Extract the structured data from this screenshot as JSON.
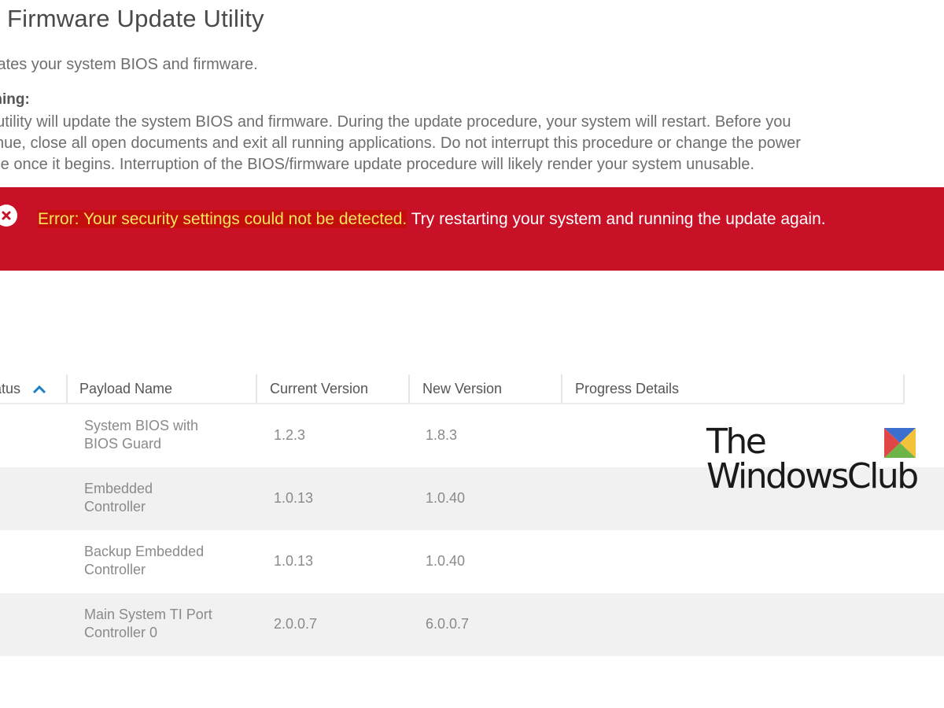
{
  "app": {
    "title": "ll Firmware Update Utility",
    "subtitle": "lates your system BIOS and firmware."
  },
  "warning": {
    "label": "rning:",
    "lines": [
      ". utility will update the system BIOS and firmware. During the update procedure, your system will restart. Before you",
      "tinue, close all open documents and exit all running applications. Do not interrupt this procedure or change the power",
      "rce once it begins. Interruption of the BIOS/firmware update procedure will likely render your system unusable."
    ]
  },
  "error": {
    "icon": "error-x-circle-icon",
    "highlight": "Error: Your security settings could not be detected.",
    "message": " Try restarting your system and running the update again.",
    "colors": {
      "background": "#c81127",
      "highlight_text": "#f8e35a"
    }
  },
  "table": {
    "columns": [
      {
        "label": "atus",
        "sort": "ascending",
        "sort_icon": "chevron-up-icon"
      },
      {
        "label": "Payload Name"
      },
      {
        "label": "Current Version"
      },
      {
        "label": "New Version"
      },
      {
        "label": "Progress Details"
      }
    ],
    "rows": [
      {
        "payload_line1": "System BIOS with",
        "payload_line2": "BIOS Guard",
        "current": "1.2.3",
        "new": "1.8.3",
        "progress": ""
      },
      {
        "payload_line1": "Embedded",
        "payload_line2": "Controller",
        "current": "1.0.13",
        "new": "1.0.40",
        "progress": ""
      },
      {
        "payload_line1": "Backup Embedded",
        "payload_line2": "Controller",
        "current": "1.0.13",
        "new": "1.0.40",
        "progress": ""
      },
      {
        "payload_line1": "Main System TI Port",
        "payload_line2": "Controller 0",
        "current": "2.0.0.7",
        "new": "6.0.0.7",
        "progress": ""
      }
    ],
    "accent": "#1a7fc4"
  },
  "watermark": {
    "line1": "The",
    "line2": "WindowsClub",
    "logo": "windows-club-logo-icon"
  }
}
